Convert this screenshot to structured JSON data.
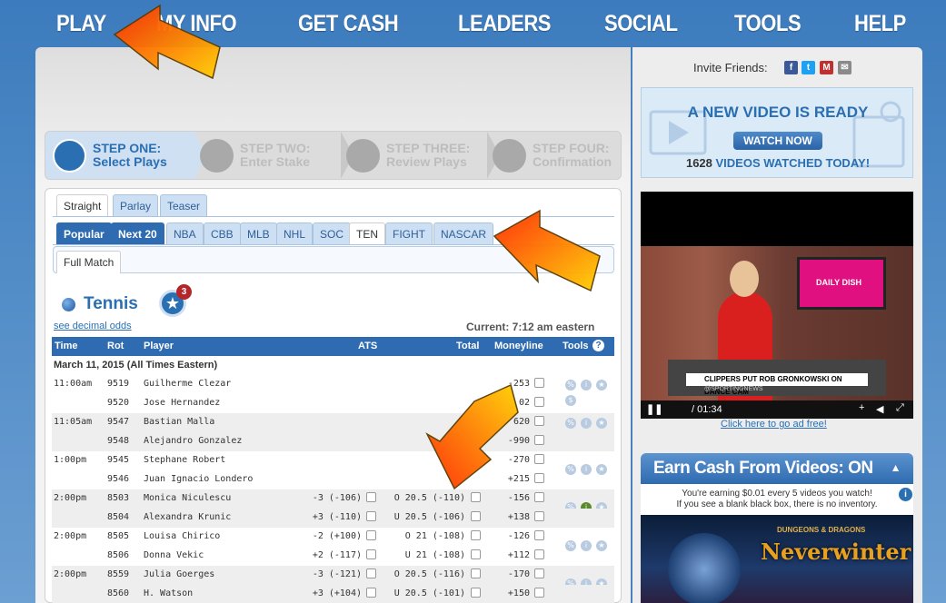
{
  "nav": {
    "items": [
      "PLAY",
      "MY INFO",
      "GET CASH",
      "LEADERS",
      "SOCIAL",
      "TOOLS",
      "HELP"
    ]
  },
  "steps": [
    {
      "title": "STEP ONE:",
      "sub": "Select Plays"
    },
    {
      "title": "STEP TWO:",
      "sub": "Enter Stake"
    },
    {
      "title": "STEP THREE:",
      "sub": "Review Plays"
    },
    {
      "title": "STEP FOUR:",
      "sub": "Confirmation"
    }
  ],
  "bet_tabs": [
    "Straight",
    "Parlay",
    "Teaser"
  ],
  "sport_tabs": [
    "Popular",
    "Next 20",
    "NBA",
    "CBB",
    "MLB",
    "NHL",
    "SOC",
    "TEN",
    "FIGHT",
    "NASCAR"
  ],
  "match_tab": "Full Match",
  "sport": {
    "title": "Tennis",
    "badge_count": "3"
  },
  "decimal_link": "see decimal odds",
  "current_time": "Current: 7:12 am eastern",
  "table": {
    "headers": [
      "Time",
      "Rot",
      "Player",
      "ATS",
      "Total",
      "Moneyline",
      "Tools"
    ],
    "date": "March 11, 2015 (All Times Eastern)",
    "rows": [
      {
        "time": "11:00am",
        "rot": "9519",
        "player": "Guilherme Clezar",
        "ats": "",
        "total": "",
        "ml": "-253"
      },
      {
        "time": "",
        "rot": "9520",
        "player": "Jose Hernandez",
        "ats": "",
        "total": "",
        "ml": "02"
      },
      {
        "time": "11:05am",
        "rot": "9547",
        "player": "Bastian Malla",
        "ats": "",
        "total": "",
        "ml": "620"
      },
      {
        "time": "",
        "rot": "9548",
        "player": "Alejandro Gonzalez",
        "ats": "",
        "total": "",
        "ml": "-990"
      },
      {
        "time": "1:00pm",
        "rot": "9545",
        "player": "Stephane Robert",
        "ats": "",
        "total": "",
        "ml": "-270"
      },
      {
        "time": "",
        "rot": "9546",
        "player": "Juan Ignacio Londero",
        "ats": "",
        "total": "",
        "ml": "+215"
      },
      {
        "time": "2:00pm",
        "rot": "8503",
        "player": "Monica Niculescu",
        "ats": "-3 (-106)",
        "total": "O 20.5 (-110)",
        "ml": "-156"
      },
      {
        "time": "",
        "rot": "8504",
        "player": "Alexandra Krunic",
        "ats": "+3 (-110)",
        "total": "U 20.5 (-106)",
        "ml": "+138"
      },
      {
        "time": "2:00pm",
        "rot": "8505",
        "player": "Louisa Chirico",
        "ats": "-2 (+100)",
        "total": "O 21 (-108)",
        "ml": "-126"
      },
      {
        "time": "",
        "rot": "8506",
        "player": "Donna Vekic",
        "ats": "+2 (-117)",
        "total": "U 21 (-108)",
        "ml": "+112"
      },
      {
        "time": "2:00pm",
        "rot": "8559",
        "player": "Julia Goerges",
        "ats": "-3 (-121)",
        "total": "O 20.5 (-116)",
        "ml": "-170"
      },
      {
        "time": "",
        "rot": "8560",
        "player": "H. Watson",
        "ats": "+3 (+104)",
        "total": "U 20.5 (-101)",
        "ml": "+150"
      }
    ]
  },
  "sidebar": {
    "invite": "Invite Friends:",
    "video_title": "A NEW VIDEO IS READY",
    "watch_now": "WATCH NOW",
    "watched_count": "1628",
    "watched_text": "VIDEOS WATCHED TODAY!",
    "player_time": "/ 01:34",
    "screen_text": "DAILY DISH",
    "ticker": "CLIPPERS PUT ROB GRONKOWSKI ON DANCE CAM",
    "ticker_sub": "@SPORTINGNEWS",
    "ad_link": "Click here to go ad free!",
    "earn_title": "Earn Cash From Videos: ON",
    "earn_line1": "You're earning $0.01 every 5 videos you watch!",
    "earn_line2": "If you see a blank black box, there is no inventory.",
    "game_title": "Neverwinter",
    "game_brand": "DUNGEONS & DRAGONS"
  },
  "colors": {
    "accent": "#2a6fb2",
    "header_bg": "#2e6bb0",
    "arrow": "#ff8a00"
  }
}
